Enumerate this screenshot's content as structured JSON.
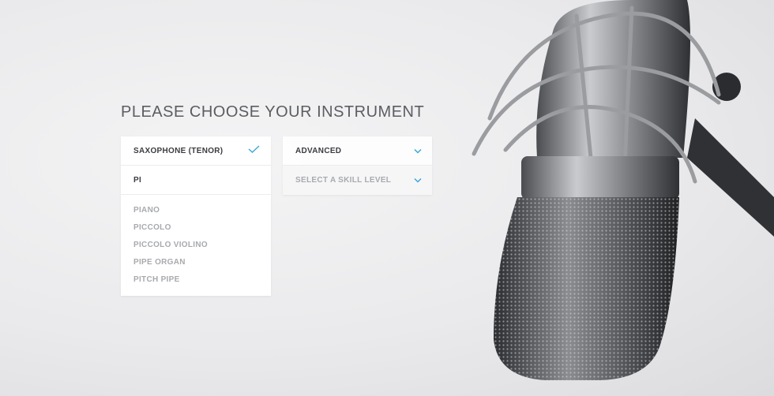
{
  "heading": "PLEASE CHOOSE YOUR INSTRUMENT",
  "instrument": {
    "selected": "SAXOPHONE (TENOR)",
    "search_value": "PI",
    "options": [
      "PIANO",
      "PICCOLO",
      "PICCOLO VIOLINO",
      "PIPE ORGAN",
      "PITCH PIPE"
    ]
  },
  "skill": {
    "selected": "ADVANCED",
    "placeholder": "SELECT A SKILL LEVEL"
  },
  "colors": {
    "accent": "#3aa8d8",
    "text_dark": "#3a3c40",
    "text_muted": "#a8aaae"
  }
}
